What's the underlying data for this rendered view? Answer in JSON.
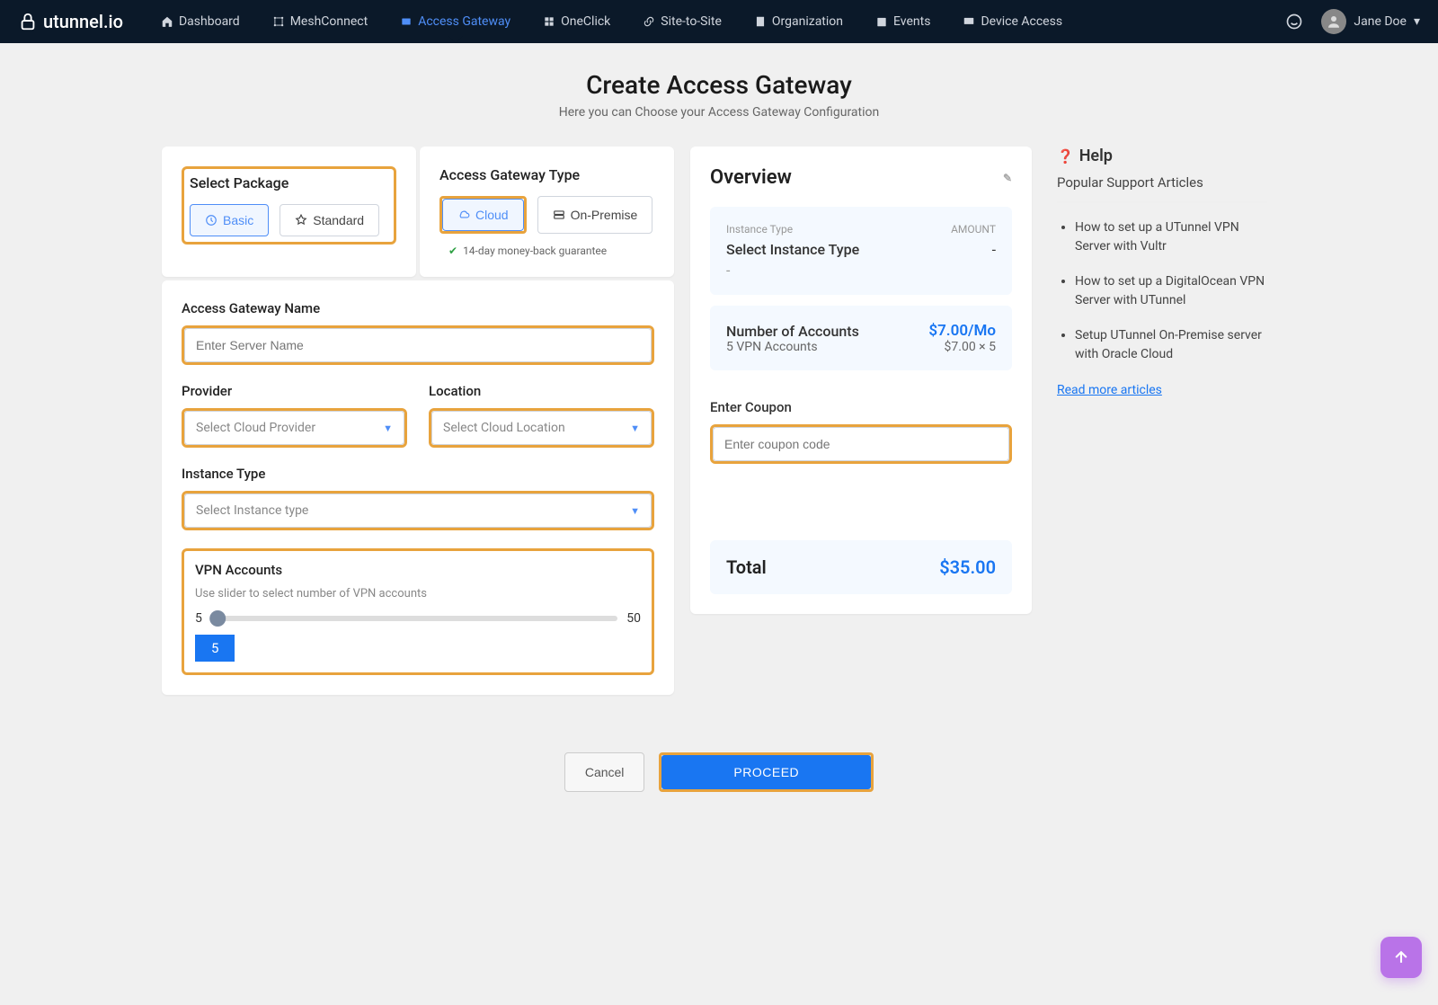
{
  "brand": "utunnel.io",
  "nav": {
    "items": [
      {
        "label": "Dashboard",
        "active": false
      },
      {
        "label": "MeshConnect",
        "active": false
      },
      {
        "label": "Access Gateway",
        "active": true
      },
      {
        "label": "OneClick",
        "active": false
      },
      {
        "label": "Site-to-Site",
        "active": false
      },
      {
        "label": "Organization",
        "active": false
      },
      {
        "label": "Events",
        "active": false
      },
      {
        "label": "Device Access",
        "active": false
      }
    ],
    "user": "Jane Doe"
  },
  "header": {
    "title": "Create Access Gateway",
    "subtitle": "Here you can Choose your Access Gateway Configuration"
  },
  "form": {
    "package": {
      "label": "Select Package",
      "basic": "Basic",
      "standard": "Standard"
    },
    "gatewayType": {
      "label": "Access Gateway Type",
      "cloud": "Cloud",
      "onprem": "On-Premise",
      "guarantee": "14-day money-back guarantee"
    },
    "name": {
      "label": "Access Gateway Name",
      "placeholder": "Enter Server Name"
    },
    "provider": {
      "label": "Provider",
      "placeholder": "Select Cloud Provider"
    },
    "location": {
      "label": "Location",
      "placeholder": "Select Cloud Location"
    },
    "instance": {
      "label": "Instance Type",
      "placeholder": "Select Instance type"
    },
    "vpn": {
      "label": "VPN Accounts",
      "hint": "Use slider to select number of VPN accounts",
      "min": "5",
      "max": "50",
      "value": "5"
    }
  },
  "overview": {
    "title": "Overview",
    "instanceTypeLabel": "Instance Type",
    "amountLabel": "AMOUNT",
    "selectInstance": "Select Instance Type",
    "dash": "-",
    "acctLabel": "Number of Accounts",
    "acctSub": "5 VPN Accounts",
    "acctPrice": "$7.00/Mo",
    "acctCalc": "$7.00 × 5",
    "couponLabel": "Enter Coupon",
    "couponPlaceholder": "Enter coupon code",
    "totalLabel": "Total",
    "totalValue": "$35.00"
  },
  "actions": {
    "cancel": "Cancel",
    "proceed": "PROCEED"
  },
  "help": {
    "title": "Help",
    "subtitle": "Popular Support Articles",
    "articles": [
      "How to set up a UTunnel VPN Server with Vultr",
      "How to set up a DigitalOcean VPN Server with UTunnel",
      "Setup UTunnel On-Premise server with Oracle Cloud"
    ],
    "more": "Read more articles"
  }
}
